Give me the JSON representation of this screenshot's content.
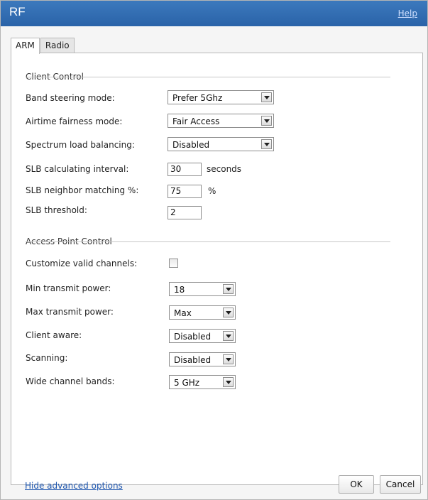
{
  "window": {
    "title": "RF",
    "help_label": "Help"
  },
  "tabs": [
    {
      "label": "ARM",
      "active": true
    },
    {
      "label": "Radio",
      "active": false
    }
  ],
  "client_control": {
    "legend": "Client Control",
    "band_steering_label": "Band steering mode:",
    "band_steering_value": "Prefer 5Ghz",
    "airtime_label": "Airtime fairness mode:",
    "airtime_value": "Fair Access",
    "spectrum_label": "Spectrum load balancing:",
    "spectrum_value": "Disabled",
    "slb_interval_label": "SLB calculating interval:",
    "slb_interval_value": "30",
    "slb_interval_unit": "seconds",
    "slb_neighbor_label": "SLB neighbor matching %:",
    "slb_neighbor_value": "75",
    "slb_neighbor_unit": "%",
    "slb_threshold_label": "SLB threshold:",
    "slb_threshold_value": "2"
  },
  "ap_control": {
    "legend": "Access Point Control",
    "customize_label": "Customize valid channels:",
    "customize_checked": false,
    "min_power_label": "Min transmit power:",
    "min_power_value": "18",
    "max_power_label": "Max transmit power:",
    "max_power_value": "Max",
    "client_aware_label": "Client aware:",
    "client_aware_value": "Disabled",
    "scanning_label": "Scanning:",
    "scanning_value": "Disabled",
    "wide_channel_label": "Wide channel bands:",
    "wide_channel_value": "5 GHz"
  },
  "footer": {
    "hide_advanced_label": "Hide advanced options",
    "ok_label": "OK",
    "cancel_label": "Cancel"
  },
  "colors": {
    "titlebar": "#2f6db3",
    "link": "#1d56b0",
    "panel_bg": "#ffffff",
    "dialog_bg": "#f5f5f5"
  }
}
